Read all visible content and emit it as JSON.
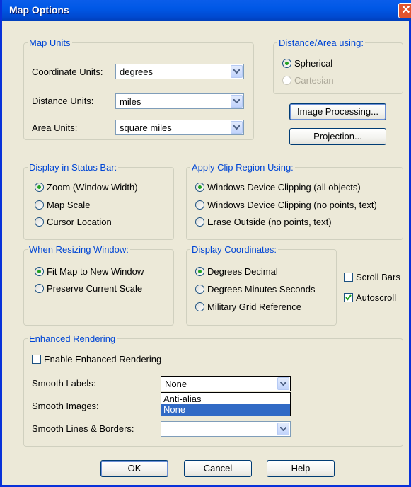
{
  "window": {
    "title": "Map Options",
    "close_glyph": "✕"
  },
  "map_units": {
    "legend": "Map Units",
    "coordinate_label": "Coordinate Units:",
    "coordinate_value": "degrees",
    "distance_label": "Distance Units:",
    "distance_value": "miles",
    "area_label": "Area Units:",
    "area_value": "square miles"
  },
  "distance_area": {
    "legend": "Distance/Area using:",
    "spherical": "Spherical",
    "cartesian": "Cartesian",
    "selected": "Spherical"
  },
  "buttons": {
    "image_processing": "Image Processing...",
    "projection": "Projection...",
    "ok": "OK",
    "cancel": "Cancel",
    "help": "Help"
  },
  "status_bar": {
    "legend": "Display in Status Bar:",
    "zoom": "Zoom (Window Width)",
    "map_scale": "Map Scale",
    "cursor_location": "Cursor Location",
    "selected": "Zoom (Window Width)"
  },
  "clip_region": {
    "legend": "Apply Clip Region Using:",
    "device_all": "Windows Device Clipping (all objects)",
    "device_no_points": "Windows Device Clipping (no points, text)",
    "erase_outside": "Erase Outside (no points, text)",
    "selected": "Windows Device Clipping (all objects)"
  },
  "resizing": {
    "legend": "When Resizing Window:",
    "fit_map": "Fit Map to New Window",
    "preserve_scale": "Preserve Current Scale",
    "selected": "Fit Map to New Window"
  },
  "coordinates": {
    "legend": "Display Coordinates:",
    "decimal": "Degrees Decimal",
    "dms": "Degrees Minutes Seconds",
    "mgrs": "Military Grid Reference",
    "selected": "Degrees Decimal"
  },
  "checkboxes": {
    "scroll_bars": "Scroll Bars",
    "scroll_bars_checked": false,
    "autoscroll": "Autoscroll",
    "autoscroll_checked": true
  },
  "enhanced": {
    "legend": "Enhanced Rendering",
    "enable_label": "Enable Enhanced Rendering",
    "enable_checked": false,
    "smooth_labels_label": "Smooth Labels:",
    "smooth_labels_value": "None",
    "smooth_images_label": "Smooth Images:",
    "smooth_lines_label": "Smooth Lines & Borders:",
    "smooth_lines_value": "",
    "dropdown_options": [
      "Anti-alias",
      "None"
    ],
    "dropdown_selected": "None"
  },
  "colors": {
    "accent": "#0046D5",
    "titlebar": "#0058E6",
    "face": "#ECE9D8",
    "selection": "#316AC5"
  }
}
